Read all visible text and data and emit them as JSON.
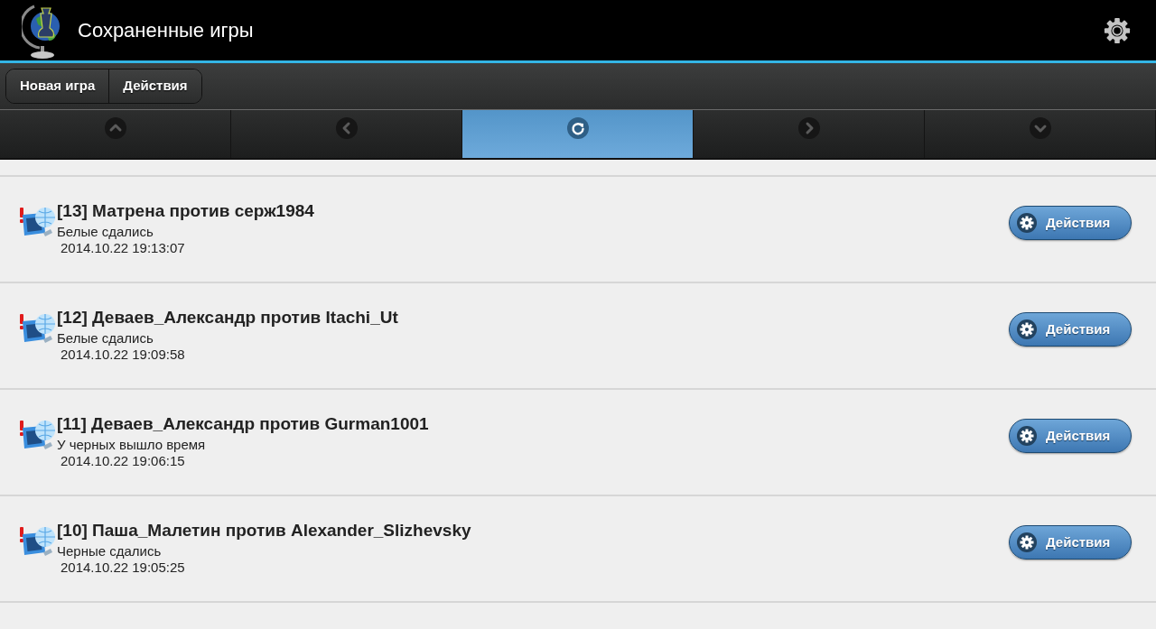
{
  "header": {
    "title": "Сохраненные игры"
  },
  "toolbar": {
    "buttons": [
      "Новая игра",
      "Действия"
    ]
  },
  "nav": [
    {
      "kind": "up",
      "selected": false
    },
    {
      "kind": "left",
      "selected": false
    },
    {
      "kind": "refresh",
      "selected": true
    },
    {
      "kind": "right",
      "selected": false
    },
    {
      "kind": "down",
      "selected": false
    }
  ],
  "games": [
    {
      "title": "[13] Матрена против серж1984",
      "result": "Белые сдались",
      "date": "2014.10.22 19:13:07",
      "action": "Действия"
    },
    {
      "title": "[12] Деваев_Александр против Itachi_Ut",
      "result": "Белые сдались",
      "date": "2014.10.22 19:09:58",
      "action": "Действия"
    },
    {
      "title": "[11] Деваев_Александр против Gurman1001",
      "result": "У черных вышло время",
      "date": "2014.10.22 19:06:15",
      "action": "Действия"
    },
    {
      "title": "[10] Паша_Малетин против Alexander_Slizhevsky",
      "result": "Черные сдались",
      "date": "2014.10.22 19:05:25",
      "action": "Действия"
    }
  ]
}
